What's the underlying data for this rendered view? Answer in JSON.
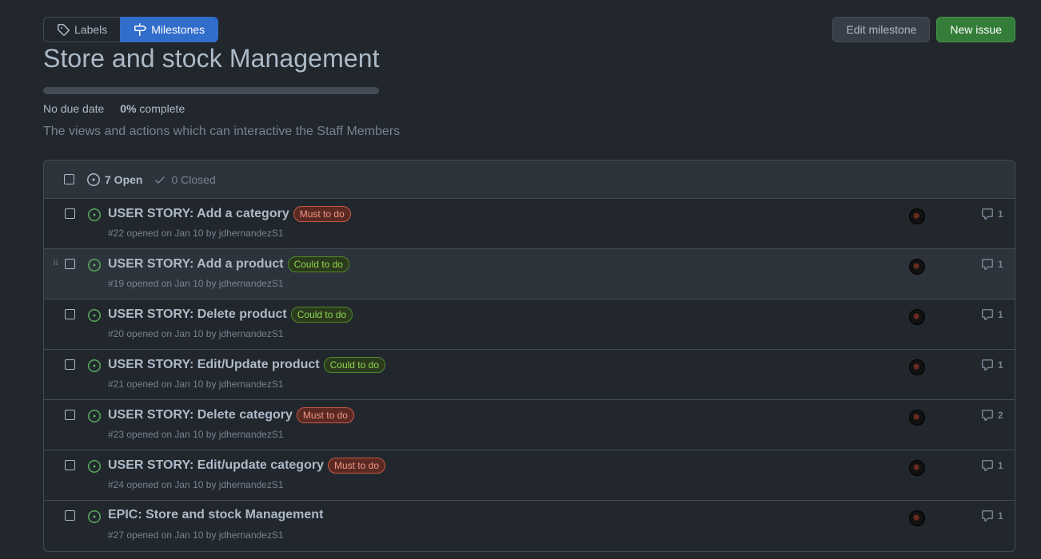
{
  "nav": {
    "labels": "Labels",
    "milestones": "Milestones"
  },
  "actions": {
    "edit_milestone": "Edit milestone",
    "new_issue": "New issue"
  },
  "milestone": {
    "title": "Store and stock Management",
    "progress_fraction": 0,
    "due": "No due date",
    "percent": "0%",
    "complete_label": "complete",
    "description": "The views and actions which can interactive the Staff Members"
  },
  "filters": {
    "open": "7 Open",
    "closed": "0 Closed"
  },
  "issues": [
    {
      "title": "USER STORY: Add a category",
      "label": "Must to do",
      "meta": "#22 opened on Jan 10 by jdhernandezS1",
      "comments": "1"
    },
    {
      "title": "USER STORY: Add a product",
      "label": "Could to do",
      "meta": "#19 opened on Jan 10 by jdhernandezS1",
      "comments": "1"
    },
    {
      "title": "USER STORY: Delete product",
      "label": "Could to do",
      "meta": "#20 opened on Jan 10 by jdhernandezS1",
      "comments": "1"
    },
    {
      "title": "USER STORY: Edit/Update product",
      "label": "Could to do",
      "meta": "#21 opened on Jan 10 by jdhernandezS1",
      "comments": "1"
    },
    {
      "title": "USER STORY: Delete category",
      "label": "Must to do",
      "meta": "#23 opened on Jan 10 by jdhernandezS1",
      "comments": "2"
    },
    {
      "title": "USER STORY: Edit/update category",
      "label": "Must to do",
      "meta": "#24 opened on Jan 10 by jdhernandezS1",
      "comments": "1"
    },
    {
      "title": "EPIC: Store and stock Management",
      "label": "",
      "meta": "#27 opened on Jan 10 by jdhernandezS1",
      "comments": "1"
    }
  ],
  "colors": {
    "open_icon": "#57ab5a",
    "primary_button": "#347d39",
    "selected_tab": "#316dca"
  }
}
